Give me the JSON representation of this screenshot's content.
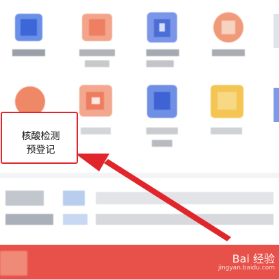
{
  "annotation": {
    "line1": "核酸检测",
    "line2": "预登记"
  },
  "watermark": {
    "brand": "Bai 经验",
    "url": "jingyan.baidu.com"
  },
  "colors": {
    "highlight": "#e0262b",
    "footer": "#e8504a",
    "blue_icon": "#5b7fe0",
    "orange_icon": "#ef8b6b",
    "yellow_icon": "#f3c34b"
  }
}
